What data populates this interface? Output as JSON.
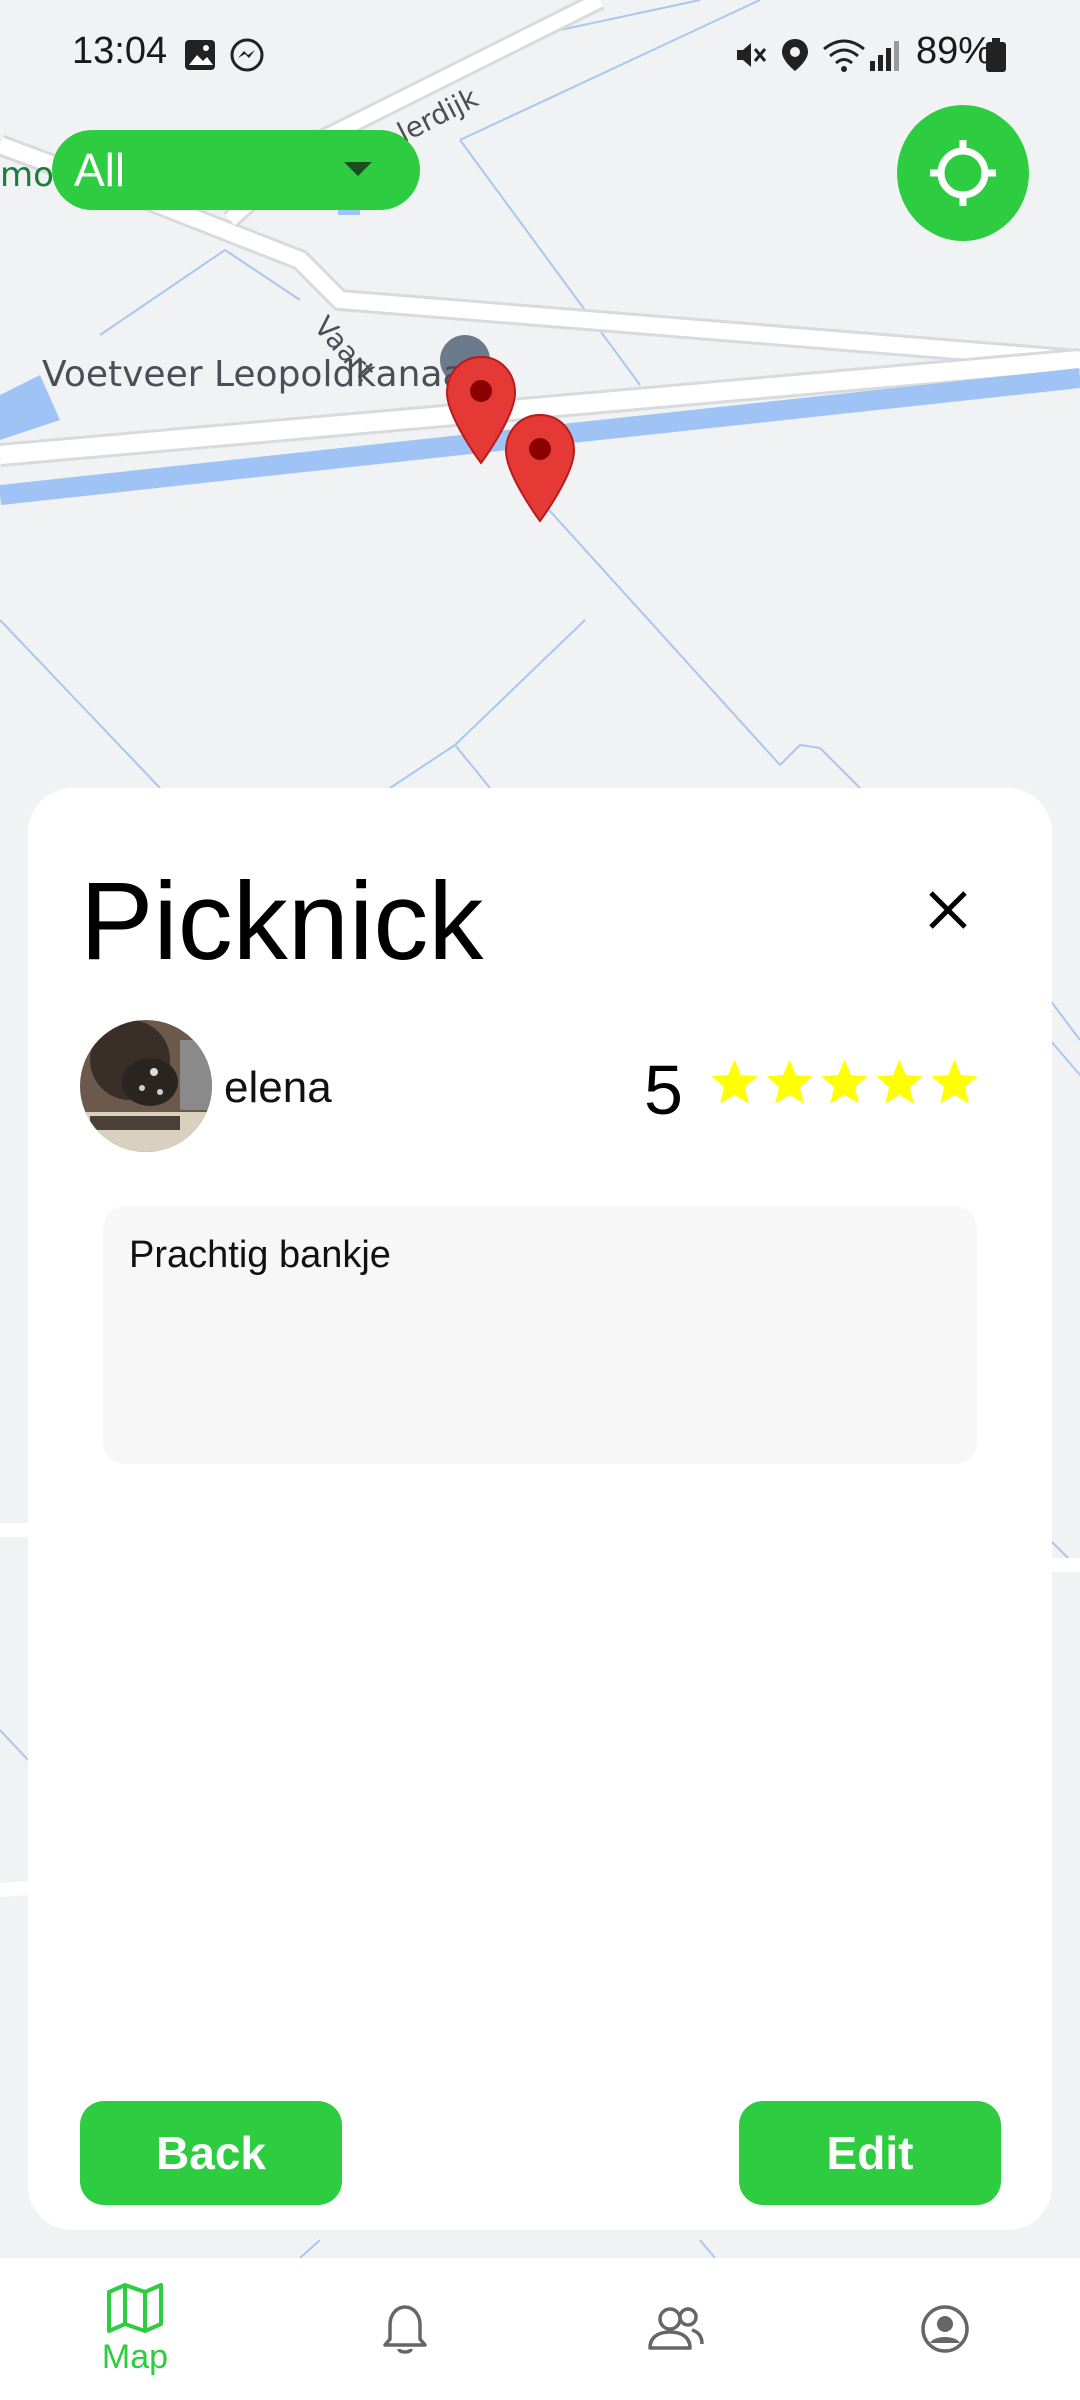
{
  "status_bar": {
    "time": "13:04",
    "battery": "89%"
  },
  "map": {
    "labels": {
      "place": "Voetveer Leopoldkanaal",
      "road_1": "Vaart",
      "road_2": "lerdijk",
      "road_3": "moo"
    }
  },
  "filter": {
    "selected": "All"
  },
  "detail": {
    "title": "Picknick",
    "user": "elena",
    "rating": "5",
    "stars": 5,
    "description": "Prachtig bankje",
    "back_label": "Back",
    "edit_label": "Edit"
  },
  "nav": {
    "items": [
      {
        "label": "Map",
        "icon": "map-icon",
        "active": true
      },
      {
        "label": "",
        "icon": "bell-icon",
        "active": false
      },
      {
        "label": "",
        "icon": "people-icon",
        "active": false
      },
      {
        "label": "",
        "icon": "profile-icon",
        "active": false
      }
    ]
  },
  "colors": {
    "accent": "#2ecc40",
    "star": "#ffff00",
    "pin": "#e53935"
  }
}
